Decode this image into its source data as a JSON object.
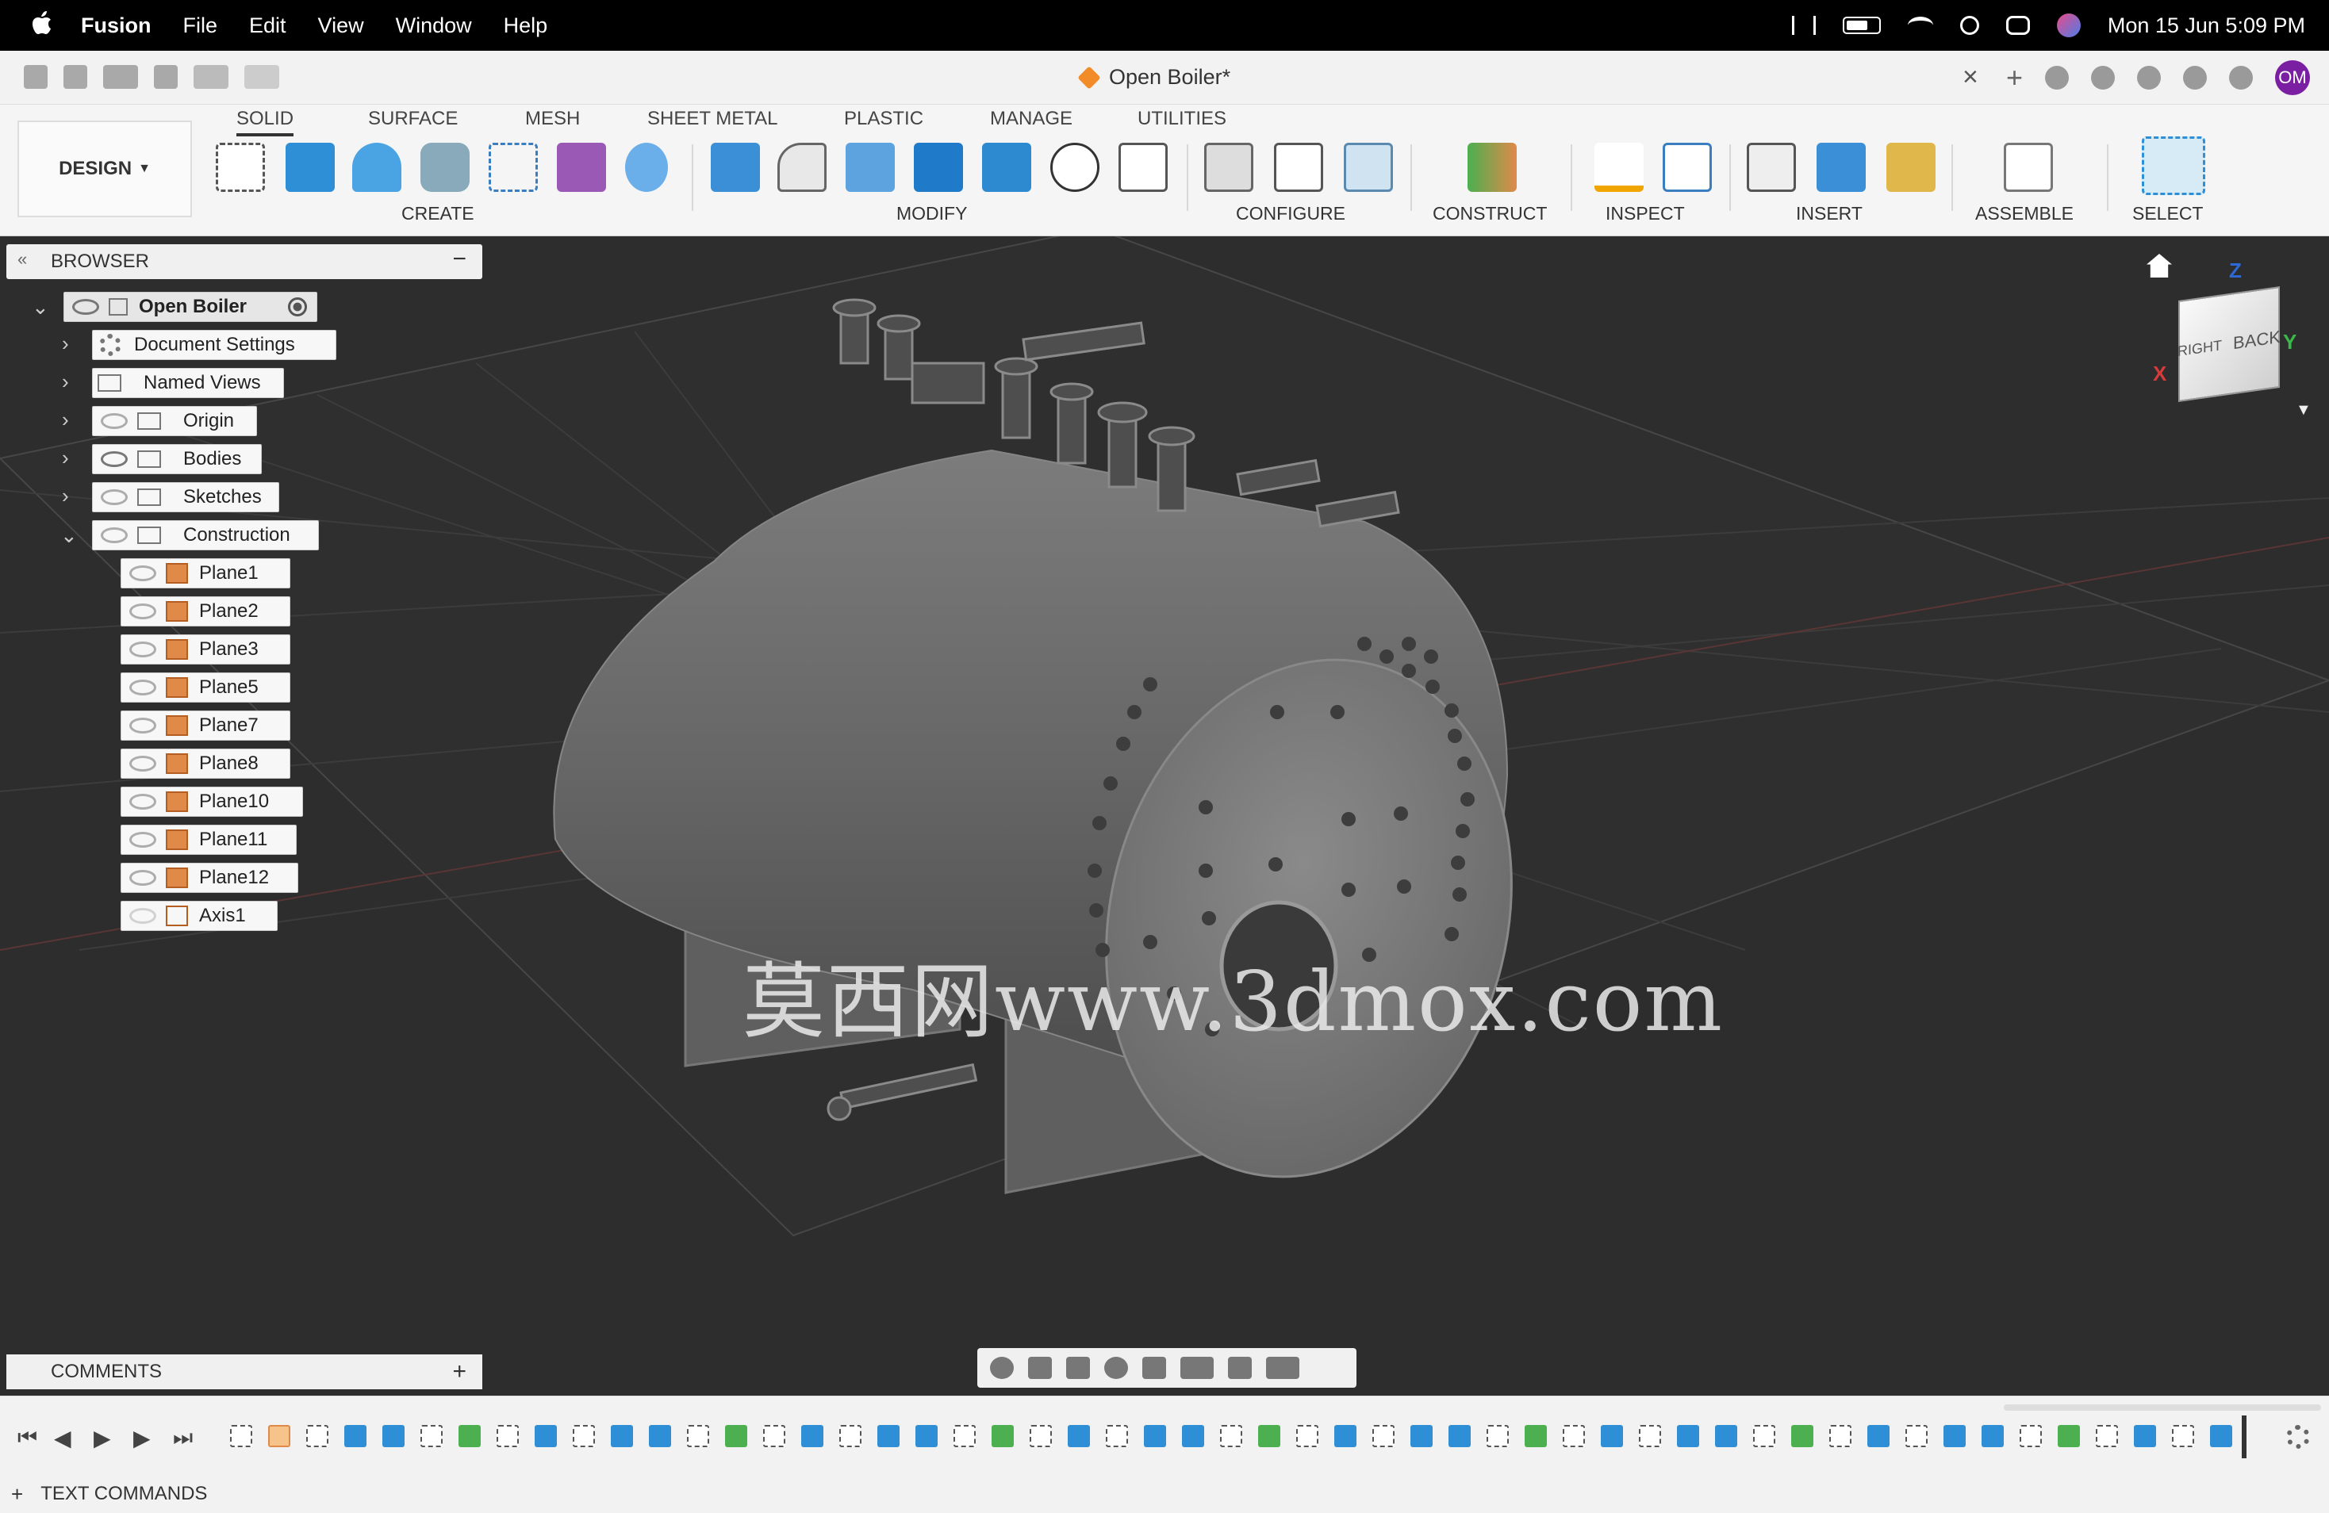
{
  "menubar": {
    "app": "Fusion",
    "items": [
      "File",
      "Edit",
      "View",
      "Window",
      "Help"
    ],
    "clock": "Mon 15 Jun  5:09 PM"
  },
  "titlebar": {
    "doc_title": "Open Boiler*",
    "avatar": "OM"
  },
  "toolbar": {
    "workspace": "DESIGN",
    "tabs": [
      "SOLID",
      "SURFACE",
      "MESH",
      "SHEET METAL",
      "PLASTIC",
      "MANAGE",
      "UTILITIES"
    ],
    "active_tab": "SOLID",
    "groups": [
      "CREATE",
      "MODIFY",
      "CONFIGURE",
      "CONSTRUCT",
      "INSPECT",
      "INSERT",
      "ASSEMBLE",
      "SELECT"
    ]
  },
  "browser": {
    "title": "BROWSER",
    "root": "Open Boiler",
    "nodes": [
      {
        "label": "Document Settings"
      },
      {
        "label": "Named Views"
      },
      {
        "label": "Origin"
      },
      {
        "label": "Bodies"
      },
      {
        "label": "Sketches"
      },
      {
        "label": "Construction"
      }
    ],
    "construction_items": [
      "Plane1",
      "Plane2",
      "Plane3",
      "Plane5",
      "Plane7",
      "Plane8",
      "Plane10",
      "Plane11",
      "Plane12",
      "Axis1"
    ]
  },
  "viewcube": {
    "right": "RIGHT",
    "back": "BACK",
    "axis_x": "X",
    "axis_y": "Y",
    "axis_z": "Z"
  },
  "watermark": "莫西网www.3dmox.com",
  "comments": {
    "title": "COMMENTS"
  },
  "textcommands": {
    "title": "TEXT COMMANDS"
  },
  "colors": {
    "accent": "#0696d7",
    "plane": "#e08a4a",
    "body": "#8a8a8a",
    "viewport": "#2d2d2d"
  }
}
